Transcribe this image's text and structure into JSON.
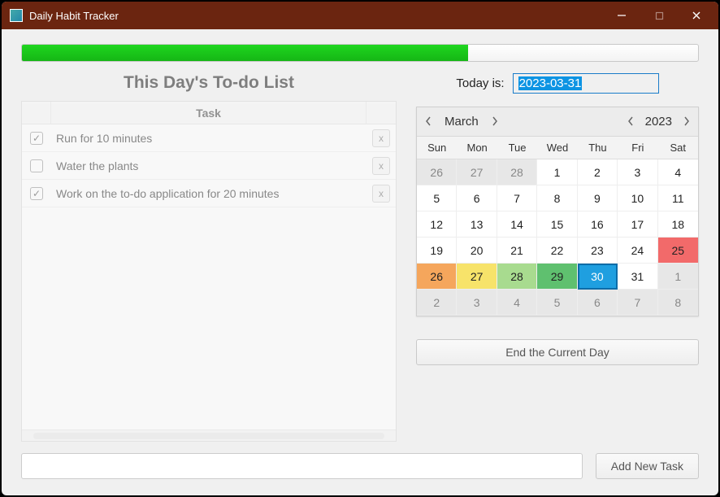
{
  "window": {
    "title": "Daily Habit Tracker"
  },
  "progress": {
    "percent": 66
  },
  "left": {
    "heading": "This Day's To-do List",
    "task_header": "Task",
    "tasks": [
      {
        "done": true,
        "text": "Run for 10 minutes",
        "del": "x"
      },
      {
        "done": false,
        "text": "Water the plants",
        "del": "x"
      },
      {
        "done": true,
        "text": "Work on the to-do application for 20 minutes",
        "del": "x"
      }
    ]
  },
  "today": {
    "label": "Today is:",
    "value_selected": "2023-03-31",
    "value_rest": ""
  },
  "calendar": {
    "month": "March",
    "year": "2023",
    "dow": [
      "Sun",
      "Mon",
      "Tue",
      "Wed",
      "Thu",
      "Fri",
      "Sat"
    ],
    "cells": [
      {
        "n": "26",
        "cls": "other"
      },
      {
        "n": "27",
        "cls": "other"
      },
      {
        "n": "28",
        "cls": "other"
      },
      {
        "n": "1",
        "cls": ""
      },
      {
        "n": "2",
        "cls": ""
      },
      {
        "n": "3",
        "cls": ""
      },
      {
        "n": "4",
        "cls": ""
      },
      {
        "n": "5",
        "cls": ""
      },
      {
        "n": "6",
        "cls": ""
      },
      {
        "n": "7",
        "cls": ""
      },
      {
        "n": "8",
        "cls": ""
      },
      {
        "n": "9",
        "cls": ""
      },
      {
        "n": "10",
        "cls": ""
      },
      {
        "n": "11",
        "cls": ""
      },
      {
        "n": "12",
        "cls": ""
      },
      {
        "n": "13",
        "cls": ""
      },
      {
        "n": "14",
        "cls": ""
      },
      {
        "n": "15",
        "cls": ""
      },
      {
        "n": "16",
        "cls": ""
      },
      {
        "n": "17",
        "cls": ""
      },
      {
        "n": "18",
        "cls": ""
      },
      {
        "n": "19",
        "cls": ""
      },
      {
        "n": "20",
        "cls": ""
      },
      {
        "n": "21",
        "cls": ""
      },
      {
        "n": "22",
        "cls": ""
      },
      {
        "n": "23",
        "cls": ""
      },
      {
        "n": "24",
        "cls": ""
      },
      {
        "n": "25",
        "cls": "red"
      },
      {
        "n": "26",
        "cls": "orange"
      },
      {
        "n": "27",
        "cls": "yellow"
      },
      {
        "n": "28",
        "cls": "lgreen"
      },
      {
        "n": "29",
        "cls": "green"
      },
      {
        "n": "30",
        "cls": "today"
      },
      {
        "n": "31",
        "cls": ""
      },
      {
        "n": "1",
        "cls": "other"
      },
      {
        "n": "2",
        "cls": "other"
      },
      {
        "n": "3",
        "cls": "other"
      },
      {
        "n": "4",
        "cls": "other"
      },
      {
        "n": "5",
        "cls": "other"
      },
      {
        "n": "6",
        "cls": "other"
      },
      {
        "n": "7",
        "cls": "other"
      },
      {
        "n": "8",
        "cls": "other"
      }
    ]
  },
  "buttons": {
    "end_day": "End the Current Day",
    "add_task": "Add New Task"
  }
}
